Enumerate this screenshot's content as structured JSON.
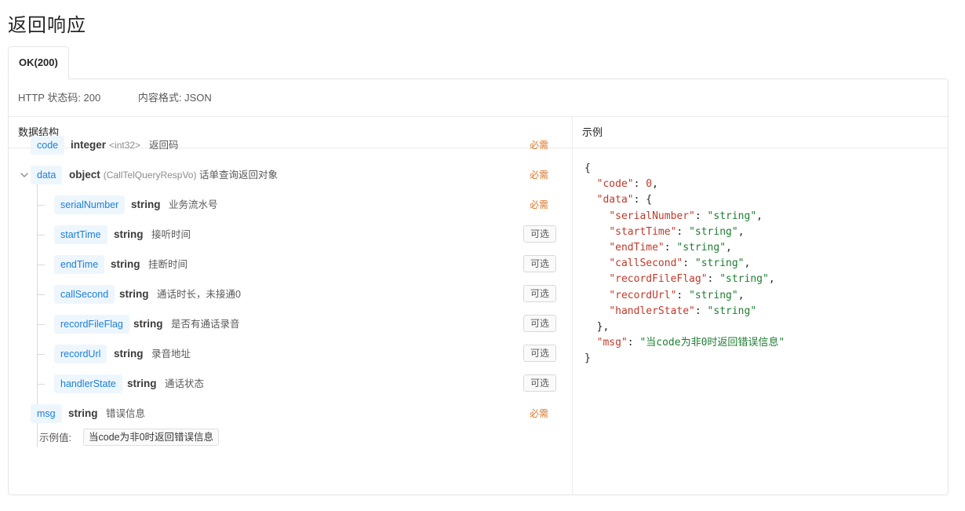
{
  "page": {
    "title": "返回响应"
  },
  "tabs": [
    {
      "label": "OK(200)"
    }
  ],
  "meta": {
    "status": "HTTP 状态码: 200",
    "format": "内容格式: JSON"
  },
  "left": {
    "header": "数据结构"
  },
  "right": {
    "header": "示例"
  },
  "fields": {
    "code": {
      "name": "code",
      "type": "integer",
      "extra": "<int32>",
      "desc": "返回码",
      "flag": "必需"
    },
    "data": {
      "name": "data",
      "type": "object",
      "extra": "(CallTelQueryRespVo)",
      "desc": "话单查询返回对象",
      "flag": "必需"
    },
    "serialNumber": {
      "name": "serialNumber",
      "type": "string",
      "desc": "业务流水号",
      "flag": "必需"
    },
    "startTime": {
      "name": "startTime",
      "type": "string",
      "desc": "接听时间",
      "flag": "可选"
    },
    "endTime": {
      "name": "endTime",
      "type": "string",
      "desc": "挂断时间",
      "flag": "可选"
    },
    "callSecond": {
      "name": "callSecond",
      "type": "string",
      "desc": "通话时长，未接通0",
      "flag": "可选"
    },
    "recordFileFlag": {
      "name": "recordFileFlag",
      "type": "string",
      "desc": "是否有通话录音",
      "flag": "可选"
    },
    "recordUrl": {
      "name": "recordUrl",
      "type": "string",
      "desc": "录音地址",
      "flag": "可选"
    },
    "handlerState": {
      "name": "handlerState",
      "type": "string",
      "desc": "通话状态",
      "flag": "可选"
    },
    "msg": {
      "name": "msg",
      "type": "string",
      "desc": "错误信息",
      "flag": "必需",
      "example_label": "示例值:",
      "example_value": "当code为非0时返回错误信息"
    }
  },
  "example_json": {
    "open": "{",
    "close": "}",
    "data_close": "},",
    "code_key": "\"code\"",
    "code_val": "0",
    "data_key": "\"data\"",
    "items": [
      {
        "key": "\"serialNumber\"",
        "val": "\"string\""
      },
      {
        "key": "\"startTime\"",
        "val": "\"string\""
      },
      {
        "key": "\"endTime\"",
        "val": "\"string\""
      },
      {
        "key": "\"callSecond\"",
        "val": "\"string\""
      },
      {
        "key": "\"recordFileFlag\"",
        "val": "\"string\""
      },
      {
        "key": "\"recordUrl\"",
        "val": "\"string\""
      },
      {
        "key": "\"handlerState\"",
        "val": "\"string\""
      }
    ],
    "msg_key": "\"msg\"",
    "msg_val": "\"当code为非0时返回错误信息\""
  },
  "icons": {
    "expand": "chevron-down-icon"
  }
}
